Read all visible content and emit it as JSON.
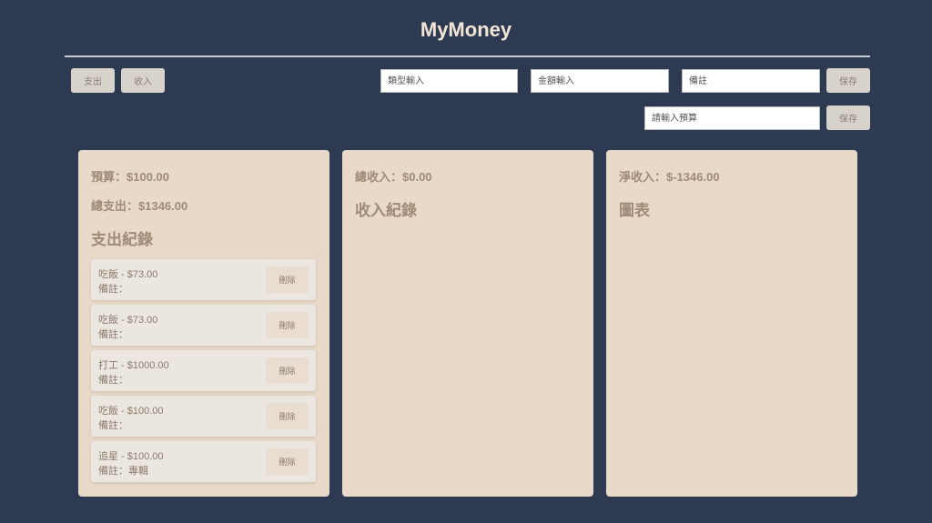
{
  "app": {
    "title": "MyMoney"
  },
  "toolbar": {
    "expense_tab": "支出",
    "income_tab": "收入",
    "type_placeholder": "類型輸入",
    "amount_placeholder": "金額輸入",
    "note_placeholder": "備註",
    "save_label": "保存",
    "budget_placeholder": "請輸入預算",
    "budget_save_label": "保存"
  },
  "expense_panel": {
    "budget": "預算：$100.00",
    "total_expense": "總支出：$1346.00",
    "heading": "支出紀錄",
    "records": [
      {
        "title": "吃飯 - $73.00",
        "note": "備註：",
        "delete_label": "刪除"
      },
      {
        "title": "吃飯 - $73.00",
        "note": "備註：",
        "delete_label": "刪除"
      },
      {
        "title": "打工 - $1000.00",
        "note": "備註：",
        "delete_label": "刪除"
      },
      {
        "title": "吃飯 - $100.00",
        "note": "備註：",
        "delete_label": "刪除"
      },
      {
        "title": "追星 - $100.00",
        "note": "備註：專輯",
        "delete_label": "刪除"
      }
    ]
  },
  "income_panel": {
    "total_income": "總收入：$0.00",
    "heading": "收入紀錄"
  },
  "net_panel": {
    "net_income": "淨收入：$-1346.00",
    "heading": "圖表"
  },
  "colors": {
    "background": "#2e3a52",
    "panel": "#e8d9c8",
    "accent_text": "#a08a78"
  }
}
